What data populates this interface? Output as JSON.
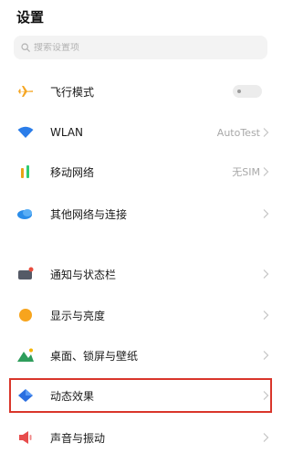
{
  "header": {
    "title": "设置"
  },
  "search": {
    "placeholder": "搜索设置项"
  },
  "settings": {
    "items": [
      {
        "label": "飞行模式",
        "icon": "airplane-icon"
      },
      {
        "label": "WLAN",
        "value": "AutoTest",
        "icon": "wifi-icon"
      },
      {
        "label": "移动网络",
        "value": "无SIM",
        "icon": "signal-bars-icon"
      },
      {
        "label": "其他网络与连接",
        "icon": "cloud-connection-icon"
      },
      {
        "label": "通知与状态栏",
        "icon": "notification-panel-icon"
      },
      {
        "label": "显示与亮度",
        "icon": "brightness-icon"
      },
      {
        "label": "桌面、锁屏与壁纸",
        "icon": "wallpaper-icon"
      },
      {
        "label": "动态效果",
        "icon": "motion-effects-icon",
        "highlighted": true
      },
      {
        "label": "声音与振动",
        "icon": "speaker-icon"
      }
    ]
  },
  "colors": {
    "highlight": "#d9362b",
    "airplane": "#f5a623",
    "wifi": "#2b7de9",
    "mobile_network": "#e8a317",
    "mobile_network_2": "#2ecc71",
    "brightness": "#f7a41d",
    "speaker": "#e74c4c"
  }
}
